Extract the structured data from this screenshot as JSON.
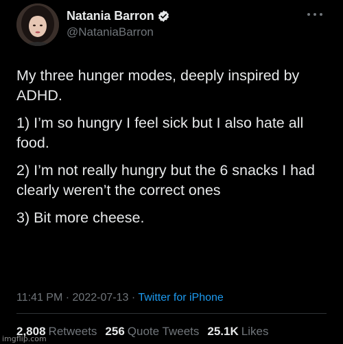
{
  "author": {
    "display_name": "Natania Barron",
    "handle": "@NataniaBarron",
    "verified_icon": "verified-badge-icon",
    "avatar_icon": "profile-photo"
  },
  "menu_icon": "more-options-icon",
  "tweet": {
    "paragraphs": [
      "My three hunger modes, deeply inspired by ADHD.",
      "1) I’m so hungry I feel sick but I also hate all food.",
      "2) I’m not really hungry but the 6 snacks I had clearly weren’t the correct ones",
      "3) Bit more cheese."
    ]
  },
  "meta": {
    "time": "11:41 PM",
    "separator": "·",
    "date": "2022-07-13",
    "source": "Twitter for iPhone"
  },
  "stats": {
    "retweets_count": "2,808",
    "retweets_label": "Retweets",
    "quotes_count": "256",
    "quotes_label": "Quote Tweets",
    "likes_count": "25.1K",
    "likes_label": "Likes"
  },
  "watermark": "imgflip.com",
  "colors": {
    "background": "#000000",
    "text": "#e7e9ea",
    "secondary": "#71767b",
    "accent": "#1d9bf0"
  }
}
